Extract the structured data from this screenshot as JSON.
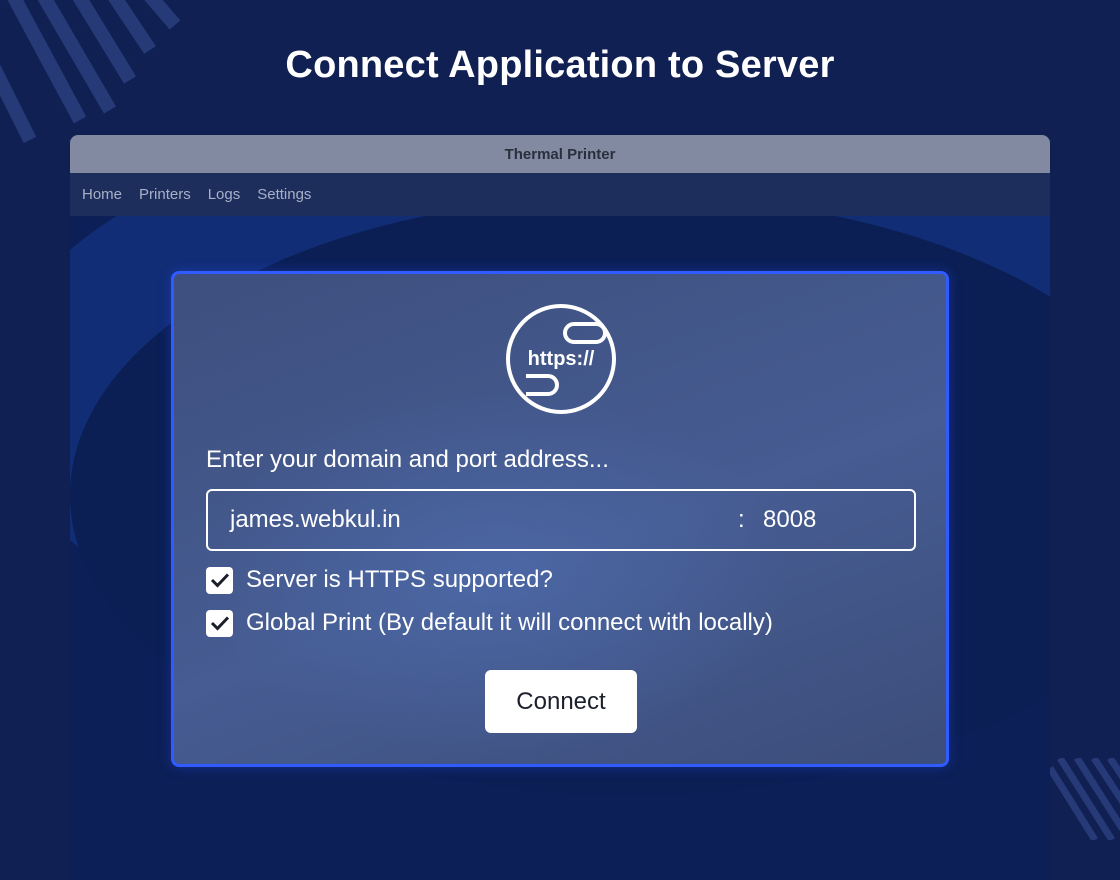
{
  "headline": "Connect Application to Server",
  "window": {
    "title": "Thermal Printer",
    "menu": [
      "Home",
      "Printers",
      "Logs",
      "Settings"
    ]
  },
  "card": {
    "logo_text": "https://",
    "prompt": "Enter your domain and port address...",
    "domain": "james.webkul.in",
    "port_separator": ":",
    "port": "8008",
    "options": [
      {
        "label": "Server is HTTPS supported?",
        "checked": true
      },
      {
        "label": "Global Print (By default it will connect with locally)",
        "checked": true
      }
    ],
    "connect_label": "Connect"
  },
  "colors": {
    "background": "#112052",
    "card_border": "#2f5bff",
    "titlebar": "#828aa1",
    "menubar": "#1d2e5d"
  },
  "icons": [
    "https-globe-icon",
    "checkmark-icon"
  ]
}
